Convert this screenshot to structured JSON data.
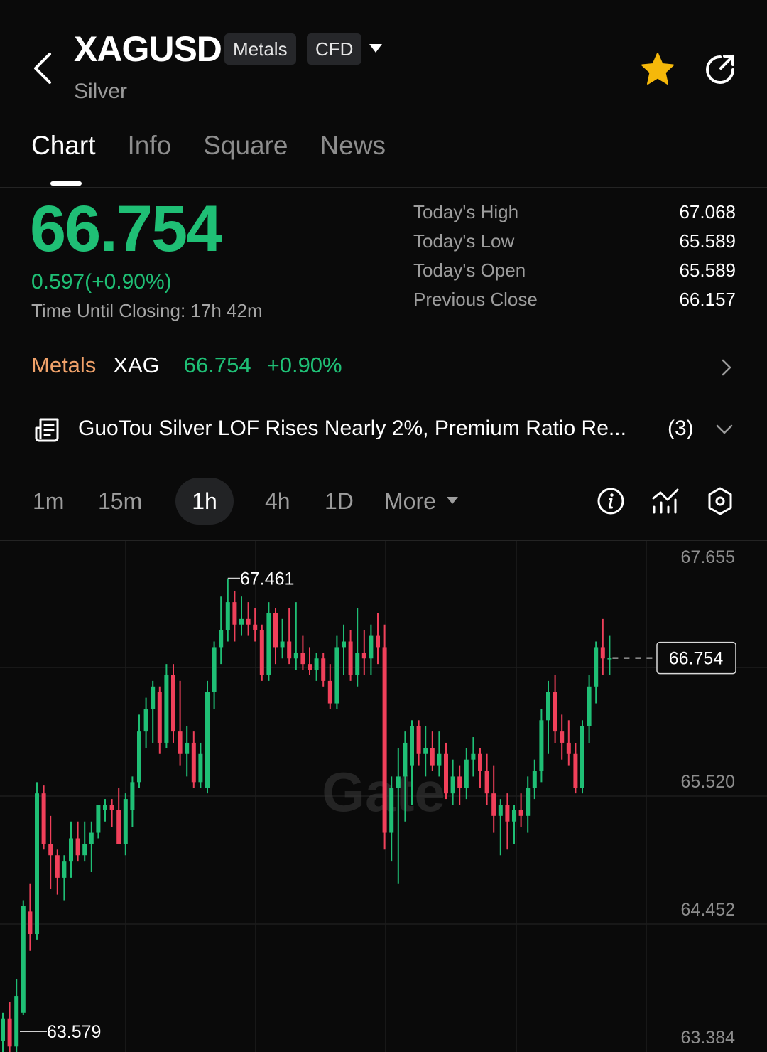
{
  "header": {
    "symbol": "XAGUSD",
    "tags": [
      "Metals",
      "CFD"
    ],
    "subtitle": "Silver",
    "icons": [
      "back-arrow-icon",
      "caret-down-icon",
      "star-icon",
      "share-icon"
    ],
    "star_color": "#f5b80a"
  },
  "tabs": [
    {
      "label": "Chart",
      "active": true
    },
    {
      "label": "Info",
      "active": false
    },
    {
      "label": "Square",
      "active": false
    },
    {
      "label": "News",
      "active": false
    }
  ],
  "quote": {
    "price": "66.754",
    "change": "0.597(+0.90%)",
    "closing_label": "Time Until Closing:",
    "closing_value": "17h 42m",
    "up_color": "#1fbf75"
  },
  "stats": [
    {
      "label": "Today's High",
      "value": "67.068"
    },
    {
      "label": "Today's Low",
      "value": "65.589"
    },
    {
      "label": "Today's Open",
      "value": "65.589"
    },
    {
      "label": "Previous Close",
      "value": "66.157"
    }
  ],
  "related": {
    "category": "Metals",
    "ticker": "XAG",
    "price": "66.754",
    "change": "+0.90%"
  },
  "news": {
    "headline": "GuoTou Silver LOF Rises Nearly 2%, Premium Ratio Re...",
    "count": "(3)"
  },
  "intervals": {
    "items": [
      "1m",
      "15m",
      "1h",
      "4h",
      "1D"
    ],
    "active": "1h",
    "more_label": "More"
  },
  "chart_data": {
    "type": "candlestick",
    "y_ticks": [
      "67.655",
      "65.520",
      "64.452",
      "63.384"
    ],
    "last_price_label": "66.754",
    "high_marker": "67.461",
    "low_marker": "63.579",
    "watermark": "Gate",
    "up_color": "#1fbf75",
    "down_color": "#f0405a",
    "candles": [
      {
        "o": 63.35,
        "h": 63.6,
        "l": 63.2,
        "c": 63.55
      },
      {
        "o": 63.55,
        "h": 63.7,
        "l": 63.2,
        "c": 63.3
      },
      {
        "o": 63.3,
        "h": 63.9,
        "l": 63.25,
        "c": 63.75
      },
      {
        "o": 63.6,
        "h": 64.6,
        "l": 63.58,
        "c": 64.55
      },
      {
        "o": 64.5,
        "h": 64.75,
        "l": 64.15,
        "c": 64.3
      },
      {
        "o": 64.3,
        "h": 65.65,
        "l": 64.25,
        "c": 65.55
      },
      {
        "o": 65.55,
        "h": 65.62,
        "l": 65.05,
        "c": 65.1
      },
      {
        "o": 65.1,
        "h": 65.35,
        "l": 64.7,
        "c": 65.0
      },
      {
        "o": 65.0,
        "h": 65.05,
        "l": 64.65,
        "c": 64.8
      },
      {
        "o": 64.8,
        "h": 65.0,
        "l": 64.6,
        "c": 64.95
      },
      {
        "o": 64.95,
        "h": 65.3,
        "l": 64.8,
        "c": 65.15
      },
      {
        "o": 65.15,
        "h": 65.3,
        "l": 64.95,
        "c": 65.0
      },
      {
        "o": 65.0,
        "h": 65.3,
        "l": 64.95,
        "c": 65.1
      },
      {
        "o": 65.1,
        "h": 65.3,
        "l": 64.85,
        "c": 65.2
      },
      {
        "o": 65.2,
        "h": 65.45,
        "l": 65.15,
        "c": 65.45
      },
      {
        "o": 65.4,
        "h": 65.5,
        "l": 65.3,
        "c": 65.45
      },
      {
        "o": 65.45,
        "h": 65.5,
        "l": 65.25,
        "c": 65.4
      },
      {
        "o": 65.4,
        "h": 65.6,
        "l": 65.1,
        "c": 65.1
      },
      {
        "o": 65.1,
        "h": 65.55,
        "l": 65.0,
        "c": 65.5
      },
      {
        "o": 65.4,
        "h": 65.7,
        "l": 65.25,
        "c": 65.65
      },
      {
        "o": 65.65,
        "h": 66.25,
        "l": 65.6,
        "c": 66.1
      },
      {
        "o": 66.1,
        "h": 66.4,
        "l": 65.95,
        "c": 66.3
      },
      {
        "o": 66.3,
        "h": 66.55,
        "l": 66.0,
        "c": 66.5
      },
      {
        "o": 66.45,
        "h": 66.5,
        "l": 65.9,
        "c": 66.0
      },
      {
        "o": 66.0,
        "h": 66.7,
        "l": 65.95,
        "c": 66.6
      },
      {
        "o": 66.6,
        "h": 66.7,
        "l": 66.0,
        "c": 66.1
      },
      {
        "o": 66.1,
        "h": 66.55,
        "l": 65.8,
        "c": 65.9
      },
      {
        "o": 65.9,
        "h": 66.15,
        "l": 65.7,
        "c": 66.0
      },
      {
        "o": 66.0,
        "h": 66.1,
        "l": 65.6,
        "c": 65.65
      },
      {
        "o": 65.65,
        "h": 66.0,
        "l": 65.6,
        "c": 65.9
      },
      {
        "o": 65.6,
        "h": 66.55,
        "l": 65.55,
        "c": 66.45
      },
      {
        "o": 66.45,
        "h": 66.9,
        "l": 66.3,
        "c": 66.85
      },
      {
        "o": 66.85,
        "h": 67.3,
        "l": 66.7,
        "c": 67.0
      },
      {
        "o": 67.0,
        "h": 67.461,
        "l": 66.9,
        "c": 67.25
      },
      {
        "o": 67.25,
        "h": 67.35,
        "l": 66.9,
        "c": 67.05
      },
      {
        "o": 67.05,
        "h": 67.3,
        "l": 66.95,
        "c": 67.1
      },
      {
        "o": 67.1,
        "h": 67.25,
        "l": 66.95,
        "c": 67.05
      },
      {
        "o": 67.05,
        "h": 67.2,
        "l": 66.9,
        "c": 67.0
      },
      {
        "o": 67.0,
        "h": 67.05,
        "l": 66.55,
        "c": 66.6
      },
      {
        "o": 66.6,
        "h": 67.25,
        "l": 66.55,
        "c": 67.15
      },
      {
        "o": 67.15,
        "h": 67.2,
        "l": 66.7,
        "c": 66.85
      },
      {
        "o": 66.85,
        "h": 67.1,
        "l": 66.75,
        "c": 66.9
      },
      {
        "o": 66.9,
        "h": 67.2,
        "l": 66.7,
        "c": 66.75
      },
      {
        "o": 66.75,
        "h": 67.25,
        "l": 66.65,
        "c": 66.8
      },
      {
        "o": 66.8,
        "h": 66.95,
        "l": 66.65,
        "c": 66.7
      },
      {
        "o": 66.7,
        "h": 66.85,
        "l": 66.6,
        "c": 66.65
      },
      {
        "o": 66.65,
        "h": 66.8,
        "l": 66.55,
        "c": 66.75
      },
      {
        "o": 66.75,
        "h": 66.8,
        "l": 66.5,
        "c": 66.55
      },
      {
        "o": 66.55,
        "h": 66.7,
        "l": 66.3,
        "c": 66.35
      },
      {
        "o": 66.35,
        "h": 66.95,
        "l": 66.3,
        "c": 66.85
      },
      {
        "o": 66.85,
        "h": 67.05,
        "l": 66.6,
        "c": 66.9
      },
      {
        "o": 66.9,
        "h": 67.0,
        "l": 66.55,
        "c": 66.6
      },
      {
        "o": 66.6,
        "h": 67.2,
        "l": 66.5,
        "c": 66.8
      },
      {
        "o": 66.8,
        "h": 67.0,
        "l": 66.6,
        "c": 66.75
      },
      {
        "o": 66.75,
        "h": 67.05,
        "l": 66.6,
        "c": 66.95
      },
      {
        "o": 66.95,
        "h": 67.15,
        "l": 66.7,
        "c": 66.85
      },
      {
        "o": 66.85,
        "h": 67.05,
        "l": 65.05,
        "c": 65.2
      },
      {
        "o": 65.2,
        "h": 65.7,
        "l": 64.95,
        "c": 65.6
      },
      {
        "o": 65.6,
        "h": 65.95,
        "l": 64.75,
        "c": 65.7
      },
      {
        "o": 65.7,
        "h": 66.1,
        "l": 65.3,
        "c": 66.0
      },
      {
        "o": 65.8,
        "h": 66.2,
        "l": 65.45,
        "c": 66.15
      },
      {
        "o": 66.15,
        "h": 66.2,
        "l": 65.8,
        "c": 65.9
      },
      {
        "o": 65.9,
        "h": 66.15,
        "l": 65.7,
        "c": 65.95
      },
      {
        "o": 65.95,
        "h": 66.1,
        "l": 65.75,
        "c": 65.8
      },
      {
        "o": 65.8,
        "h": 66.1,
        "l": 65.7,
        "c": 65.9
      },
      {
        "o": 65.9,
        "h": 66.0,
        "l": 65.5,
        "c": 65.55
      },
      {
        "o": 65.55,
        "h": 65.85,
        "l": 65.45,
        "c": 65.7
      },
      {
        "o": 65.7,
        "h": 65.8,
        "l": 65.45,
        "c": 65.6
      },
      {
        "o": 65.6,
        "h": 65.95,
        "l": 65.5,
        "c": 65.85
      },
      {
        "o": 65.85,
        "h": 66.05,
        "l": 65.7,
        "c": 65.9
      },
      {
        "o": 65.9,
        "h": 65.95,
        "l": 65.6,
        "c": 65.75
      },
      {
        "o": 65.75,
        "h": 65.9,
        "l": 65.45,
        "c": 65.55
      },
      {
        "o": 65.55,
        "h": 65.8,
        "l": 65.2,
        "c": 65.35
      },
      {
        "o": 65.35,
        "h": 65.5,
        "l": 65.0,
        "c": 65.45
      },
      {
        "o": 65.45,
        "h": 65.55,
        "l": 65.05,
        "c": 65.3
      },
      {
        "o": 65.3,
        "h": 65.45,
        "l": 65.1,
        "c": 65.4
      },
      {
        "o": 65.4,
        "h": 65.55,
        "l": 65.25,
        "c": 65.35
      },
      {
        "o": 65.35,
        "h": 65.7,
        "l": 65.2,
        "c": 65.6
      },
      {
        "o": 65.6,
        "h": 65.85,
        "l": 65.5,
        "c": 65.75
      },
      {
        "o": 65.75,
        "h": 66.3,
        "l": 65.65,
        "c": 66.2
      },
      {
        "o": 66.2,
        "h": 66.55,
        "l": 65.9,
        "c": 66.45
      },
      {
        "o": 66.45,
        "h": 66.6,
        "l": 66.0,
        "c": 66.1
      },
      {
        "o": 66.1,
        "h": 66.25,
        "l": 65.85,
        "c": 66.0
      },
      {
        "o": 66.0,
        "h": 66.2,
        "l": 65.8,
        "c": 65.9
      },
      {
        "o": 65.9,
        "h": 66.0,
        "l": 65.55,
        "c": 65.6
      },
      {
        "o": 65.6,
        "h": 66.2,
        "l": 65.55,
        "c": 66.15
      },
      {
        "o": 66.15,
        "h": 66.6,
        "l": 66.0,
        "c": 66.5
      },
      {
        "o": 66.5,
        "h": 66.9,
        "l": 66.35,
        "c": 66.85
      },
      {
        "o": 66.85,
        "h": 67.1,
        "l": 66.6,
        "c": 66.75
      },
      {
        "o": 66.75,
        "h": 66.95,
        "l": 66.6,
        "c": 66.754
      }
    ]
  }
}
